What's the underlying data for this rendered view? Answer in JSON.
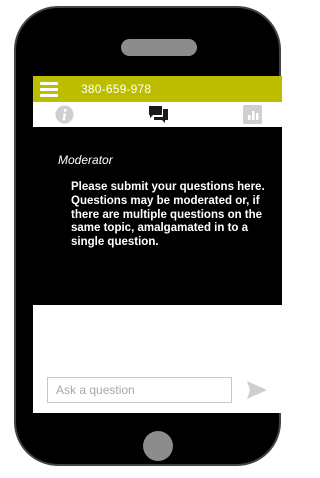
{
  "app": {
    "title": "380-659-978"
  },
  "tabs": [
    {
      "icon": "info-icon",
      "active": false
    },
    {
      "icon": "chat-icon",
      "active": true
    },
    {
      "icon": "poll-chart-icon",
      "active": false
    }
  ],
  "chat": {
    "moderator_label": "Moderator",
    "message": "Please submit your questions here. Questions may be moderated or, if there are multiple questions on the same topic, amalgamated in to a single question."
  },
  "composer": {
    "placeholder": "Ask a question",
    "send_icon": "send-icon"
  },
  "colors": {
    "accent": "#bdbd00",
    "phone_body": "#000000",
    "inactive_icon": "#cfcfcf",
    "active_icon": "#1a1a1a",
    "send_icon": "#cfcfcf"
  }
}
